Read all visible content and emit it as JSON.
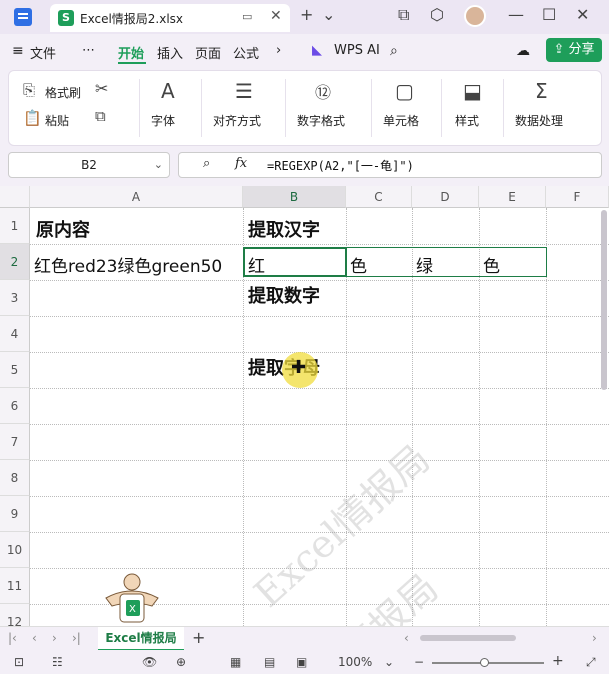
{
  "titlebar": {
    "tab_title": "Excel情报局2.xlsx",
    "tab_icon": "S",
    "monitor_icon": "monitor-icon",
    "close_icon": "close-icon",
    "add_icon": "+",
    "dropdown_icon": "⌄"
  },
  "menubar": {
    "file_label": "文件",
    "more_label": "⋯",
    "tabs": [
      "开始",
      "插入",
      "页面",
      "公式"
    ],
    "wps_ai_label": "WPS AI",
    "share_label": "分享"
  },
  "ribbon": {
    "format_painter": "格式刷",
    "paste": "粘贴",
    "font": "字体",
    "align": "对齐方式",
    "number_format": "数字格式",
    "cell": "单元格",
    "style": "样式",
    "data_processing": "数据处理"
  },
  "formula_bar": {
    "name_box": "B2",
    "fx_label": "fx",
    "formula": "=REGEXP(A2,\"[一-龟]\")"
  },
  "sheet": {
    "columns": [
      "A",
      "B",
      "C",
      "D",
      "E",
      "F"
    ],
    "rows": [
      "1",
      "2",
      "3",
      "4",
      "5",
      "6",
      "7",
      "8",
      "9",
      "10",
      "11",
      "12"
    ],
    "cells": {
      "A1": "原内容",
      "B1": "提取汉字",
      "A2": "红色red23绿色green50",
      "B2": "红",
      "C2": "色",
      "D2": "绿",
      "E2": "色",
      "B3": "提取数字",
      "B5": "提取字母"
    },
    "watermark": "Excel情报局",
    "watermark2": "情报局"
  },
  "sheet_tabs": {
    "active_tab": "Excel情报局",
    "add_label": "+"
  },
  "status_bar": {
    "zoom": "100%",
    "zoom_minus": "−",
    "zoom_plus": "+"
  },
  "colors": {
    "accent": "#1e9e5a",
    "selection": "#1e7d46"
  }
}
